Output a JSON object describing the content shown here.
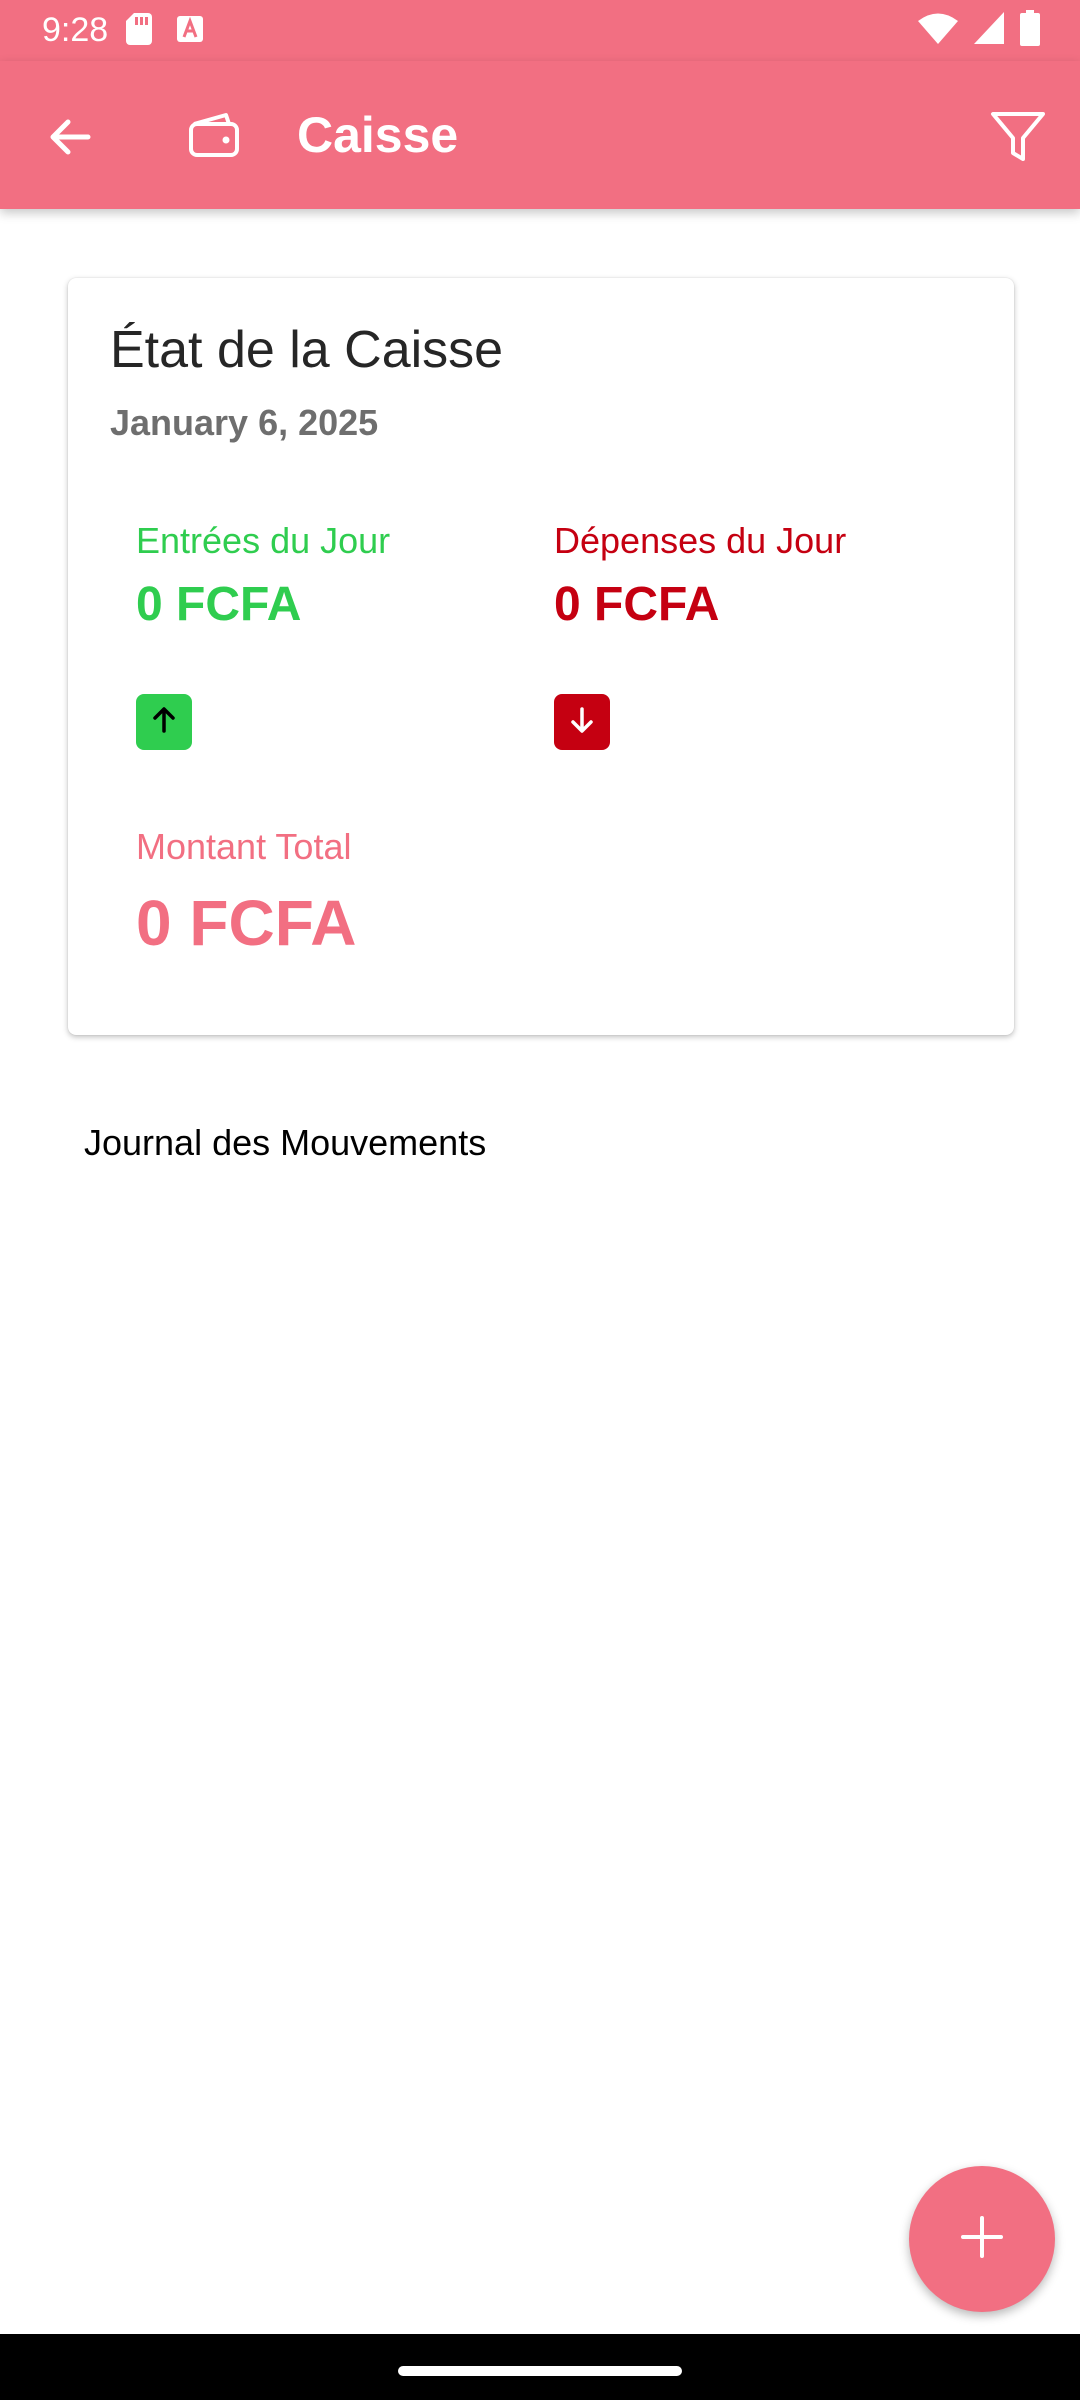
{
  "status_bar": {
    "time": "9:28",
    "left_icons": [
      "sd-card-icon",
      "keyboard-a-icon"
    ],
    "right_icons": [
      "wifi-icon",
      "signal-icon",
      "battery-icon"
    ]
  },
  "app_bar": {
    "title": "Caisse",
    "icons": [
      "back-arrow-icon",
      "wallet-icon",
      "filter-icon"
    ],
    "background_color": "#f26f82"
  },
  "summary_card": {
    "title": "État de la Caisse",
    "date": "January 6, 2025",
    "income": {
      "label": "Entrées du Jour",
      "value": "0 FCFA",
      "color": "#2fcd4f",
      "icon": "arrow-up-icon"
    },
    "expenses": {
      "label": "Dépenses du Jour",
      "value": "0 FCFA",
      "color": "#c50011",
      "icon": "arrow-down-icon"
    },
    "total": {
      "label": "Montant Total",
      "value": "0 FCFA",
      "color": "#f26f82"
    }
  },
  "journal": {
    "title": "Journal des Mouvements",
    "entries": []
  },
  "fab": {
    "icon": "plus-icon"
  }
}
